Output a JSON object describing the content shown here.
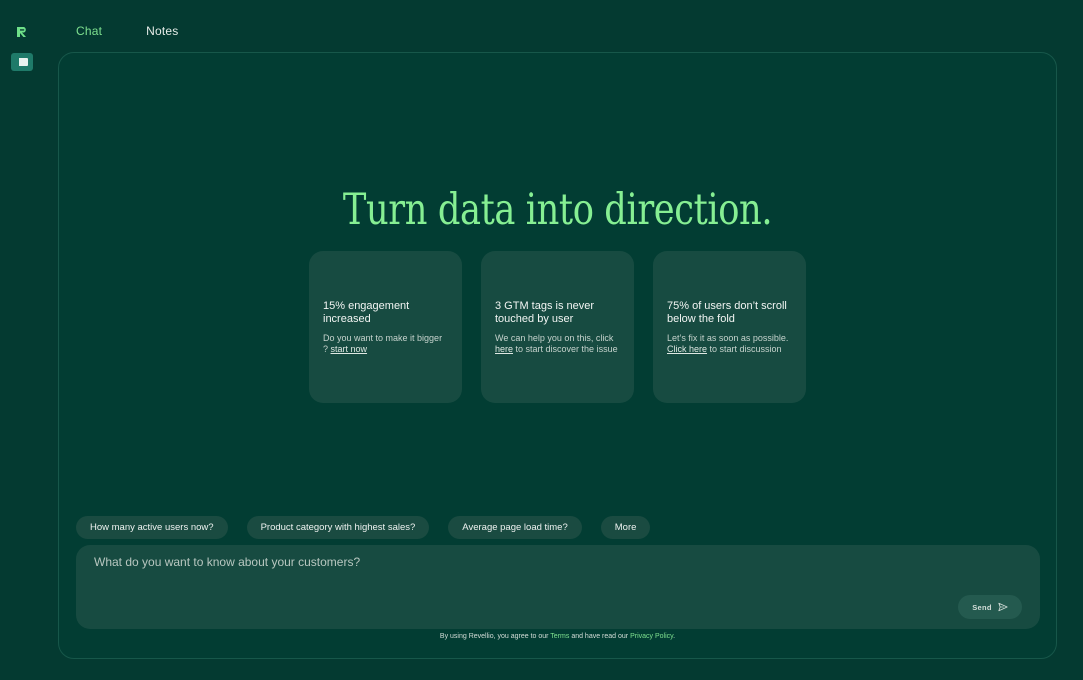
{
  "tabs": [
    {
      "label": "Chat",
      "active": true
    },
    {
      "label": "Notes",
      "active": false
    }
  ],
  "hero": {
    "title": "Turn data into direction."
  },
  "cards": [
    {
      "title": "15% engagement increased",
      "body_pre": "Do you want to make it bigger ?",
      "link": "start now",
      "body_post": ""
    },
    {
      "title": "3 GTM tags is never touched by user",
      "body_pre": "We can help you on this, click",
      "link": "here",
      "body_post": "to start discover the issue"
    },
    {
      "title": "75% of users don’t scroll below the fold",
      "body_pre": "Let’s fix it as soon as possible.",
      "link": "Click here",
      "body_post": "to start discussion"
    }
  ],
  "chips": [
    "How many active users now?",
    "Product category with highest sales?",
    "Average page load time?",
    "More"
  ],
  "composer": {
    "placeholder": "What do you want to know about your customers?",
    "value": "",
    "send_label": "Send"
  },
  "legal": {
    "prefix": "By using Revellio, you agree to our",
    "terms": "Terms",
    "middle": "and have read our",
    "privacy": "Privacy Policy",
    "suffix": "."
  },
  "colors": {
    "background": "#043a31",
    "accent": "#7ee08f",
    "card": "#174b41"
  },
  "icons": {
    "logo": "brand-r-icon",
    "panel_toggle": "sidebar-toggle-icon",
    "send": "paper-plane-icon"
  }
}
